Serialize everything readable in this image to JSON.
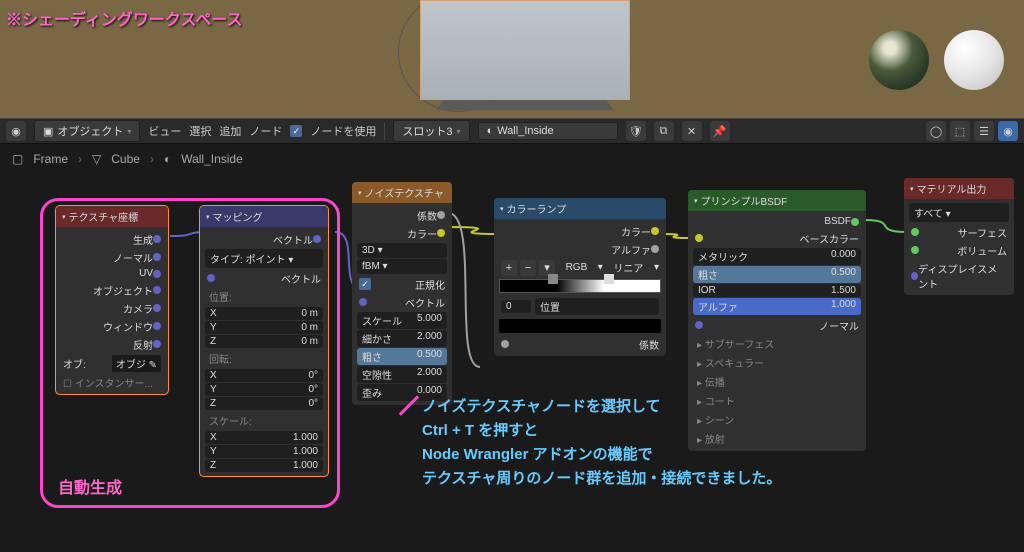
{
  "annotations": {
    "top": "※シェーディングワークスペース",
    "auto_gen": "自動生成",
    "bottom_line1": "ノイズテクスチャノードを選択して",
    "bottom_line2": "Ctrl + T を押すと",
    "bottom_line3": "Node Wrangler アドオンの機能で",
    "bottom_line4": "テクスチャ周りのノード群を追加・接続できました。"
  },
  "header": {
    "mode": "オブジェクト",
    "view": "ビュー",
    "select": "選択",
    "add": "追加",
    "node": "ノード",
    "use_nodes": "ノードを使用",
    "slot": "スロット3",
    "material": "Wall_Inside"
  },
  "breadcrumb": {
    "frame": "Frame",
    "cube": "Cube",
    "mat": "Wall_Inside"
  },
  "nodes": {
    "texcoord": {
      "title": "テクスチャ座標",
      "outputs": [
        "生成",
        "ノーマル",
        "UV",
        "オブジェクト",
        "カメラ",
        "ウィンドウ",
        "反射"
      ],
      "obj_label": "オブ:",
      "obj_val": "オブジ",
      "instancer": "インスタンサー..."
    },
    "mapping": {
      "title": "マッピング",
      "vector_out": "ベクトル",
      "type_label": "タイプ:",
      "type_val": "ポイント",
      "vector_in": "ベクトル",
      "loc": "位置:",
      "rot": "回転:",
      "scale": "スケール:",
      "x": "X",
      "y": "Y",
      "z": "Z",
      "zero_m": "0 m",
      "zero_deg": "0°",
      "one": "1.000"
    },
    "noise": {
      "title": "ノイズテクスチャ",
      "fac": "係数",
      "color": "カラー",
      "dim": "3D",
      "fbm": "fBM",
      "normalize": "正規化",
      "vector": "ベクトル",
      "scale": "スケール",
      "scale_v": "5.000",
      "detail": "細かさ",
      "detail_v": "2.000",
      "rough": "粗さ",
      "rough_v": "0.500",
      "lac": "空隙性",
      "lac_v": "2.000",
      "dist": "歪み",
      "dist_v": "0.000"
    },
    "ramp": {
      "title": "カラーランプ",
      "color": "カラー",
      "alpha": "アルファ",
      "rgb": "RGB",
      "linear": "リニア",
      "pos": "位置",
      "zero": "0",
      "fac": "係数"
    },
    "bsdf": {
      "title": "プリンシプルBSDF",
      "bsdf_out": "BSDF",
      "base": "ベースカラー",
      "metallic": "メタリック",
      "metallic_v": "0.000",
      "rough": "粗さ",
      "rough_v": "0.500",
      "ior": "IOR",
      "ior_v": "1.500",
      "alpha": "アルファ",
      "alpha_v": "1.000",
      "normal": "ノーマル",
      "subsurface": "サブサーフェス",
      "specular": "スペキュラー",
      "trans": "伝播",
      "coat": "コート",
      "sheen": "シーン",
      "emit": "放射"
    },
    "output": {
      "title": "マテリアル出力",
      "all": "すべて",
      "surface": "サーフェス",
      "volume": "ボリューム",
      "disp": "ディスプレイスメント"
    }
  }
}
